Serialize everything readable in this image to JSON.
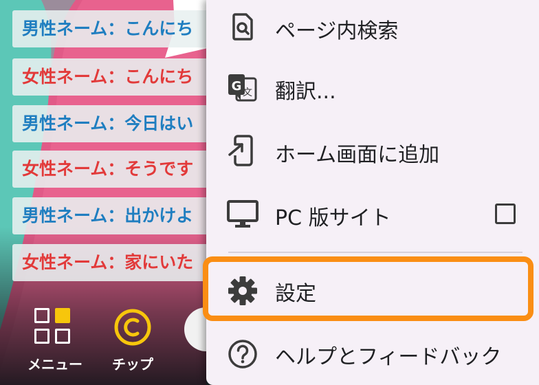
{
  "chat": {
    "lines": [
      {
        "speaker": "男性ネーム",
        "sep": "：",
        "text": "こんにち",
        "gender": "male"
      },
      {
        "speaker": "女性ネーム",
        "sep": "：",
        "text": "こんにち",
        "gender": "female"
      },
      {
        "speaker": "男性ネーム",
        "sep": "：",
        "text": "今日はい",
        "gender": "male"
      },
      {
        "speaker": "女性ネーム",
        "sep": "：",
        "text": "そうです",
        "gender": "female"
      },
      {
        "speaker": "男性ネーム",
        "sep": "：",
        "text": "出かけよ",
        "gender": "male"
      },
      {
        "speaker": "女性ネーム",
        "sep": "：",
        "text": "家にいた",
        "gender": "female"
      }
    ]
  },
  "bottom_bar": {
    "menu_label": "メニュー",
    "tip_label": "チップ",
    "menu_icon": "grid-menu-icon",
    "tip_icon": "coin-c-icon"
  },
  "overflow_menu": {
    "items": [
      {
        "label": "ページ内検索",
        "icon": "find-in-page-icon"
      },
      {
        "label": "翻訳...",
        "icon": "translate-icon"
      },
      {
        "label": "ホーム画面に追加",
        "icon": "add-to-home-screen-icon"
      },
      {
        "label": "PC 版サイト",
        "icon": "desktop-icon",
        "checkbox_checked": false
      },
      {
        "label": "設定",
        "icon": "settings-gear-icon",
        "highlighted": true
      },
      {
        "label": "ヘルプとフィードバック",
        "icon": "help-icon"
      }
    ]
  },
  "colors": {
    "male_text": "#1f7ec0",
    "female_text": "#e23a3a",
    "highlight": "#fa8e14",
    "menu_bg": "#f6f0f7",
    "teal_bg": "#5cc7b7",
    "pink_bg": "#e8628e",
    "accent_yellow": "#f7c60c"
  }
}
